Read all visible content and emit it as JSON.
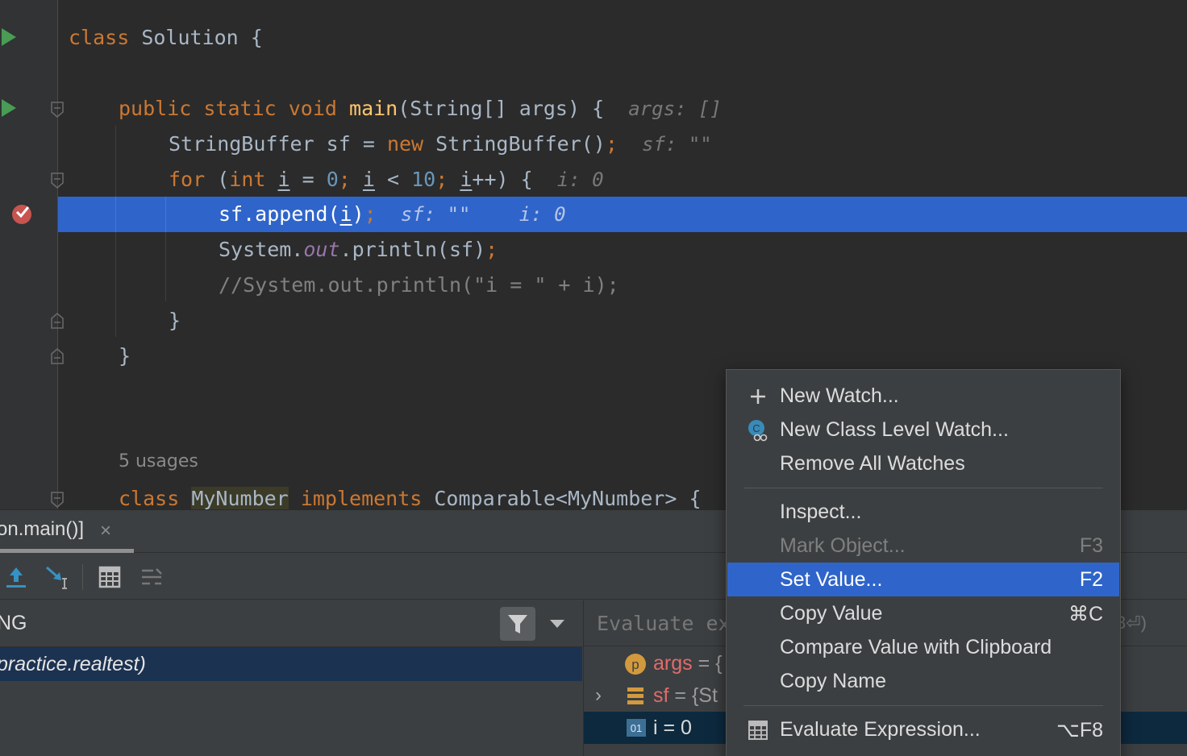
{
  "editor": {
    "lines": {
      "class_kw": "class",
      "class_name": " Solution {",
      "main_public": "public",
      "main_static": "static",
      "main_void": "void",
      "main_name": "main",
      "main_rest": "(String[] args) {",
      "main_hint": "args: []",
      "sb_type": "StringBuffer sf = ",
      "sb_new": "new",
      "sb_ctor": " StringBuffer()",
      "sb_semi": ";",
      "sb_hint": "sf: \"\"",
      "for_kw": "for",
      "for_open": " (",
      "for_int": "int",
      "for_i1": "i",
      "for_eq": " = ",
      "for_zero": "0",
      "for_semi1": ";",
      "for_i2": "i",
      "for_lt": " < ",
      "for_ten": "10",
      "for_semi2": ";",
      "for_i3": "i",
      "for_inc": "++) {",
      "for_hint": "i: 0",
      "append_pre": "sf.append(",
      "append_i": "i",
      "append_post": ")",
      "append_semi": ";",
      "append_hint1": "sf: \"\"",
      "append_hint2": "i: 0",
      "print_sys": "System.",
      "print_out": "out",
      "print_rest": ".println(sf)",
      "print_semi": ";",
      "comment": "//System.out.println(\"i = \" + i);",
      "close_for": "}",
      "close_main": "}",
      "usages": "5 usages",
      "mynum_kw": "class",
      "mynum_name": "MyNumber",
      "mynum_impl": "implements",
      "mynum_rest": " Comparable<MyNumber> {"
    }
  },
  "debug": {
    "session_tab": "on.main()]",
    "tab_close": "×",
    "thread_label": "NG",
    "frame": "practice.realtest)",
    "eval_placeholder": "Evaluate ex",
    "eval_suffix": "3⏎)",
    "vars": [
      {
        "name": "args",
        "value": " = {"
      },
      {
        "name": "sf",
        "value": " = {St"
      },
      {
        "name": "i",
        "value": " = 0"
      }
    ],
    "expand_arrow": "›"
  },
  "context_menu": {
    "items": [
      {
        "label": "New Watch...",
        "shortcut": "",
        "icon": "plus-icon"
      },
      {
        "label": "New Class Level Watch...",
        "shortcut": "",
        "icon": "class-watch-icon"
      },
      {
        "label": "Remove All Watches",
        "shortcut": ""
      },
      {
        "label": "Inspect...",
        "shortcut": ""
      },
      {
        "label": "Mark Object...",
        "shortcut": "F3",
        "disabled": true
      },
      {
        "label": "Set Value...",
        "shortcut": "F2",
        "selected": true
      },
      {
        "label": "Copy Value",
        "shortcut": "⌘C"
      },
      {
        "label": "Compare Value with Clipboard",
        "shortcut": ""
      },
      {
        "label": "Copy Name",
        "shortcut": ""
      },
      {
        "label": "Evaluate Expression...",
        "shortcut": "⌥F8",
        "icon": "calculator-icon"
      }
    ]
  },
  "colors": {
    "keyword": "#cc7832",
    "function": "#ffc66d",
    "number": "#6897bb",
    "field": "#9876aa",
    "execution_line": "#2f65ca",
    "menu_selection": "#2f65ca"
  }
}
